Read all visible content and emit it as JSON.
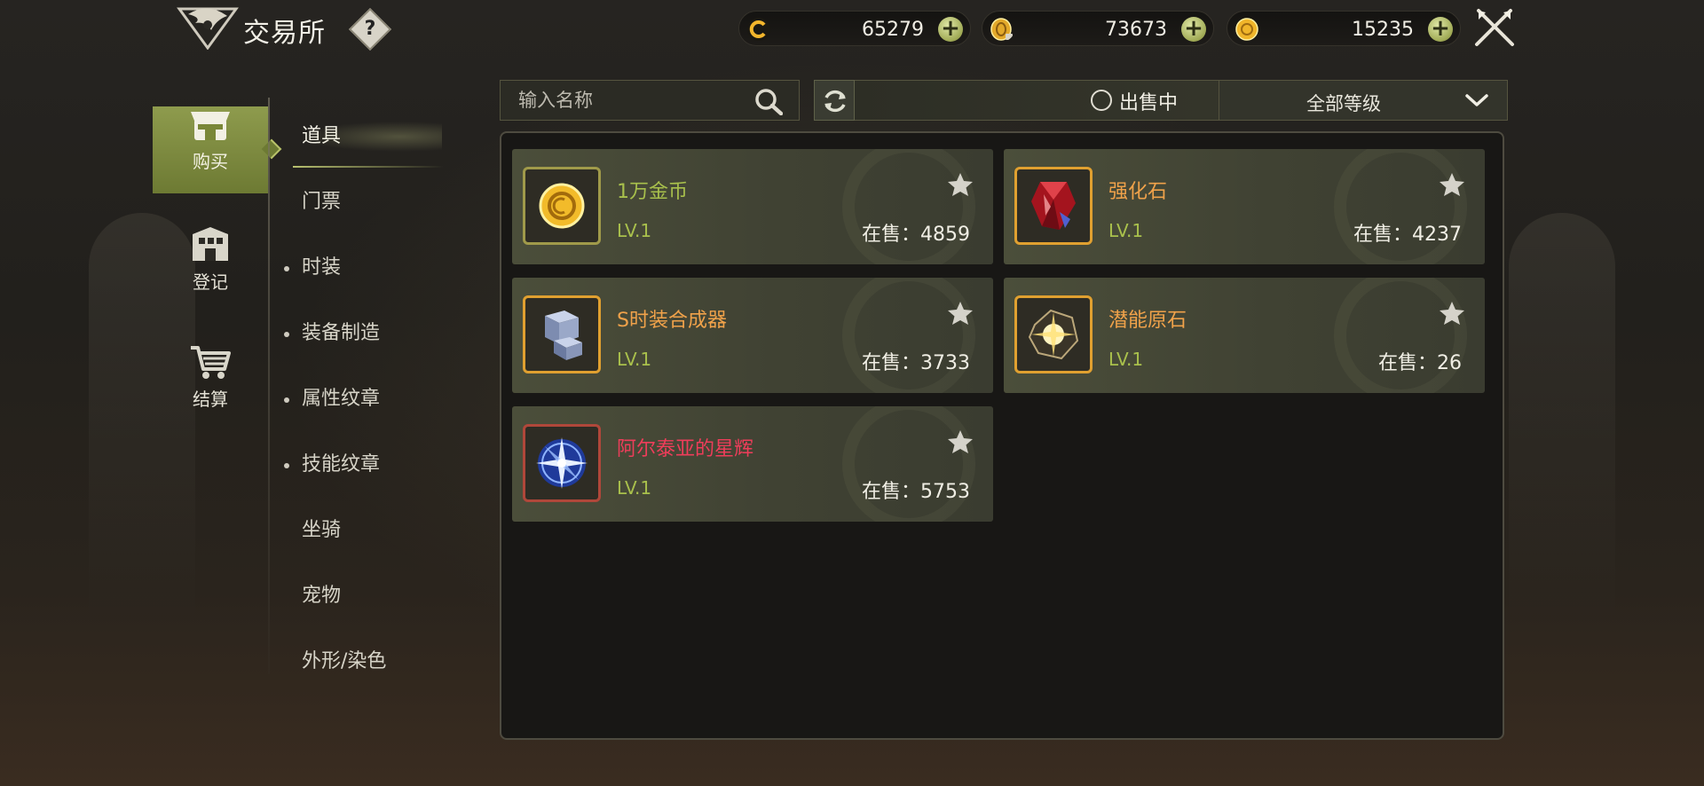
{
  "header": {
    "title": "交易所",
    "help_icon": "question-icon",
    "help_label": "?",
    "close_icon": "crossed-swords-close-icon"
  },
  "currencies": [
    {
      "icon": "c-coin-icon",
      "value": "65279",
      "add_label": "+"
    },
    {
      "icon": "bound-gold-coin-icon",
      "value": "73673",
      "add_label": "+"
    },
    {
      "icon": "gold-coin-icon",
      "value": "15235",
      "add_label": "+"
    }
  ],
  "main_nav": [
    {
      "label": "购买",
      "icon": "shop-icon",
      "active": true
    },
    {
      "label": "登记",
      "icon": "building-icon",
      "active": false
    },
    {
      "label": "结算",
      "icon": "cart-icon",
      "active": false
    }
  ],
  "sub_nav": [
    {
      "label": "道具",
      "bullet": false,
      "active": true
    },
    {
      "label": "门票",
      "bullet": false,
      "active": false
    },
    {
      "label": "时装",
      "bullet": true,
      "active": false
    },
    {
      "label": "装备制造",
      "bullet": true,
      "active": false
    },
    {
      "label": "属性纹章",
      "bullet": true,
      "active": false
    },
    {
      "label": "技能纹章",
      "bullet": true,
      "active": false
    },
    {
      "label": "坐骑",
      "bullet": false,
      "active": false
    },
    {
      "label": "宠物",
      "bullet": false,
      "active": false
    },
    {
      "label": "外形/染色",
      "bullet": false,
      "active": false
    }
  ],
  "filters": {
    "search_placeholder": "输入名称",
    "on_sale_label": "出售中",
    "level_select": "全部等级"
  },
  "items": [
    {
      "name": "1万金币",
      "level": "LV.1",
      "on_sale": "在售：4859",
      "name_color": "green",
      "icon": "gold-coin-item-icon"
    },
    {
      "name": "强化石",
      "level": "LV.1",
      "on_sale": "在售：4237",
      "name_color": "orange",
      "icon": "red-gem-icon"
    },
    {
      "name": "S时装合成器",
      "level": "LV.1",
      "on_sale": "在售：3733",
      "name_color": "orange",
      "icon": "synthesizer-cube-icon"
    },
    {
      "name": "潜能原石",
      "level": "LV.1",
      "on_sale": "在售：26",
      "name_color": "orange",
      "icon": "potential-stone-icon"
    },
    {
      "name": "阿尔泰亚的星辉",
      "level": "LV.1",
      "on_sale": "在售：5753",
      "name_color": "red",
      "icon": "star-compass-icon"
    }
  ],
  "colors": {
    "accent_green": "#8e9b4d",
    "name_green": "#a8c04c",
    "name_orange": "#f0a24a",
    "name_red": "#ee3d5a"
  }
}
